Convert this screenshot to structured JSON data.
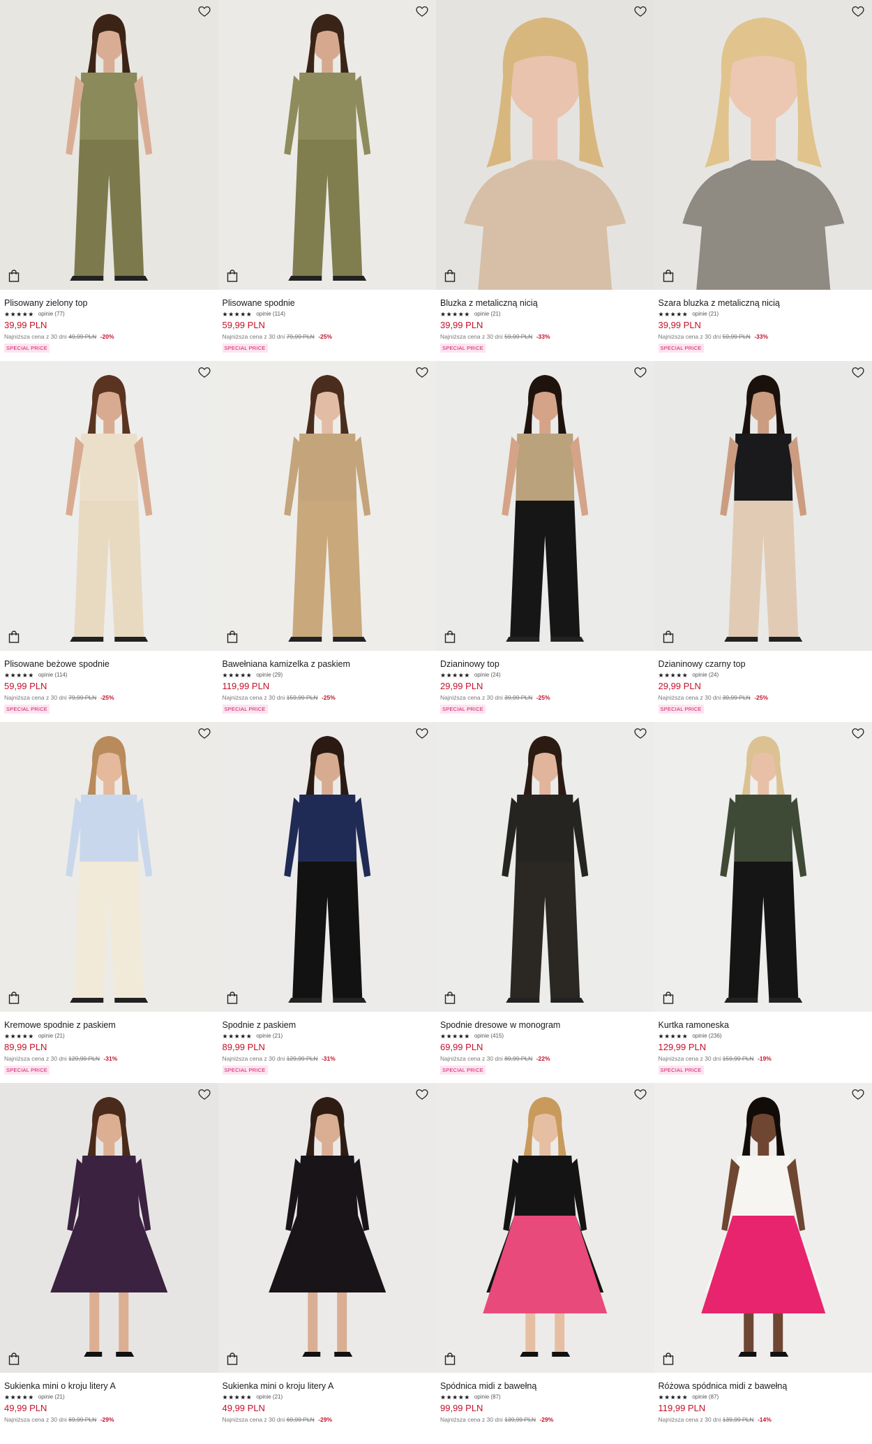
{
  "products": [
    {
      "name": "Plisowany zielony top",
      "stars": "★★★★★",
      "reviews": "opinie (77)",
      "price": "39,99 PLN",
      "lowest_label": "Najniższa cena z 30 dni",
      "old_price": "49,99 PLN",
      "discount": "-20%",
      "badge": "SPECIAL PRICE",
      "palette": {
        "bg": "#e8e6e1",
        "top": "#8a8a5a",
        "bottom": "#7c7a4c",
        "skin": "#d9ad94",
        "hair": "#3b2416"
      }
    },
    {
      "name": "Plisowane spodnie",
      "stars": "★★★★★",
      "reviews": "opinie (114)",
      "price": "59,99 PLN",
      "lowest_label": "Najniższa cena z 30 dni",
      "old_price": "79,99 PLN",
      "discount": "-25%",
      "badge": "SPECIAL PRICE",
      "palette": {
        "bg": "#ebeae6",
        "top": "#8e8b5c",
        "bottom": "#807d4f",
        "skin": "#d6a98f",
        "hair": "#3a2418"
      }
    },
    {
      "name": "Bluzka z metaliczną nicią",
      "stars": "★★★★★",
      "reviews": "opinie (21)",
      "price": "39,99 PLN",
      "lowest_label": "Najniższa cena z 30 dni",
      "old_price": "59,99 PLN",
      "discount": "-33%",
      "badge": "SPECIAL PRICE",
      "palette": {
        "bg": "#e4e3df",
        "top": "#d6bfa6",
        "bottom": "#d6bfa6",
        "skin": "#e9c3ad",
        "hair": "#d8b77e"
      }
    },
    {
      "name": "Szara bluzka z metaliczną nicią",
      "stars": "★★★★★",
      "reviews": "opinie (21)",
      "price": "39,99 PLN",
      "lowest_label": "Najniższa cena z 30 dni",
      "old_price": "59,99 PLN",
      "discount": "-33%",
      "badge": "SPECIAL PRICE",
      "palette": {
        "bg": "#e6e5e2",
        "top": "#8f8a82",
        "bottom": "#8f8a82",
        "skin": "#ecc8b3",
        "hair": "#e1c48d"
      }
    },
    {
      "name": "Plisowane beżowe spodnie",
      "stars": "★★★★★",
      "reviews": "opinie (114)",
      "price": "59,99 PLN",
      "lowest_label": "Najniższa cena z 30 dni",
      "old_price": "79,99 PLN",
      "discount": "-25%",
      "badge": "SPECIAL PRICE",
      "palette": {
        "bg": "#ededeb",
        "top": "#ecdfca",
        "bottom": "#e8d9c1",
        "skin": "#d8ab90",
        "hair": "#5a3421"
      }
    },
    {
      "name": "Bawełniana kamizelka z paskiem",
      "stars": "★★★★★",
      "reviews": "opinie (29)",
      "price": "119,99 PLN",
      "lowest_label": "Najniższa cena z 30 dni",
      "old_price": "159,99 PLN",
      "discount": "-25%",
      "badge": "SPECIAL PRICE",
      "palette": {
        "bg": "#eeedea",
        "top": "#c4a47a",
        "bottom": "#c9a87c",
        "skin": "#e2bca5",
        "hair": "#4a2d1d"
      }
    },
    {
      "name": "Dzianinowy top",
      "stars": "★★★★★",
      "reviews": "opinie (24)",
      "price": "29,99 PLN",
      "lowest_label": "Najniższa cena z 30 dni",
      "old_price": "39,99 PLN",
      "discount": "-25%",
      "badge": "SPECIAL PRICE",
      "palette": {
        "bg": "#ebebe9",
        "top": "#b9a27c",
        "bottom": "#161616",
        "skin": "#d4a388",
        "hair": "#1f130e"
      }
    },
    {
      "name": "Dzianinowy czarny top",
      "stars": "★★★★★",
      "reviews": "opinie (24)",
      "price": "29,99 PLN",
      "lowest_label": "Najniższa cena z 30 dni",
      "old_price": "39,99 PLN",
      "discount": "-25%",
      "badge": "SPECIAL PRICE",
      "palette": {
        "bg": "#e9e9e7",
        "top": "#1a1a1d",
        "bottom": "#e1cbb4",
        "skin": "#cc9c80",
        "hair": "#1a110c"
      }
    },
    {
      "name": "Kremowe spodnie z paskiem",
      "stars": "★★★★★",
      "reviews": "opinie (21)",
      "price": "89,99 PLN",
      "lowest_label": "Najniższa cena z 30 dni",
      "old_price": "129,99 PLN",
      "discount": "-31%",
      "badge": "SPECIAL PRICE",
      "palette": {
        "bg": "#ecebe8",
        "top": "#c9d7ec",
        "bottom": "#f1ead9",
        "skin": "#e4b99c",
        "hair": "#b98a5a"
      }
    },
    {
      "name": "Spodnie z paskiem",
      "stars": "★★★★★",
      "reviews": "opinie (21)",
      "price": "89,99 PLN",
      "lowest_label": "Najniższa cena z 30 dni",
      "old_price": "129,99 PLN",
      "discount": "-31%",
      "badge": "SPECIAL PRICE",
      "palette": {
        "bg": "#ecebea",
        "top": "#1f2a55",
        "bottom": "#121212",
        "skin": "#d7ab90",
        "hair": "#2a1a12"
      }
    },
    {
      "name": "Spodnie dresowe w monogram",
      "stars": "★★★★★",
      "reviews": "opinie (415)",
      "price": "69,99 PLN",
      "lowest_label": "Najniższa cena z 30 dni",
      "old_price": "89,99 PLN",
      "discount": "-22%",
      "badge": "SPECIAL PRICE",
      "palette": {
        "bg": "#ececea",
        "top": "#262421",
        "bottom": "#2b2823",
        "skin": "#e0b59b",
        "hair": "#2b1b12"
      }
    },
    {
      "name": "Kurtka ramoneska",
      "stars": "★★★★★",
      "reviews": "opinie (236)",
      "price": "129,99 PLN",
      "lowest_label": "Najniższa cena z 30 dni",
      "old_price": "159,99 PLN",
      "discount": "-19%",
      "badge": "SPECIAL PRICE",
      "palette": {
        "bg": "#eeeeec",
        "top": "#3f4a36",
        "bottom": "#151515",
        "skin": "#e8c0a7",
        "hair": "#dcc292"
      }
    },
    {
      "name": "Sukienka mini o kroju litery A",
      "stars": "★★★★★",
      "reviews": "opinie (21)",
      "price": "49,99 PLN",
      "lowest_label": "Najniższa cena z 30 dni",
      "old_price": "69,99 PLN",
      "discount": "-29%",
      "badge": "",
      "palette": {
        "bg": "#e6e5e3",
        "top": "#3a2240",
        "bottom": "#2a1a2e",
        "skin": "#dcae92",
        "hair": "#4a2a1a"
      }
    },
    {
      "name": "Sukienka mini o kroju litery A",
      "stars": "★★★★★",
      "reviews": "opinie (21)",
      "price": "49,99 PLN",
      "lowest_label": "Najniższa cena z 30 dni",
      "old_price": "69,99 PLN",
      "discount": "-29%",
      "badge": "",
      "palette": {
        "bg": "#ebeae8",
        "top": "#181418",
        "bottom": "#1a161a",
        "skin": "#d9ae93",
        "hair": "#2e1c13"
      }
    },
    {
      "name": "Spódnica midi z bawełną",
      "stars": "★★★★★",
      "reviews": "opinie (87)",
      "price": "99,99 PLN",
      "lowest_label": "Najniższa cena z 30 dni",
      "old_price": "139,99 PLN",
      "discount": "-29%",
      "badge": "",
      "palette": {
        "bg": "#ecebe9",
        "top": "#141414",
        "bottom": "#e84a7c",
        "skin": "#e6bfa3",
        "hair": "#c89a5c"
      }
    },
    {
      "name": "Różowa spódnica midi z bawełną",
      "stars": "★★★★★",
      "reviews": "opinie (87)",
      "price": "119,99 PLN",
      "lowest_label": "Najniższa cena z 30 dni",
      "old_price": "139,99 PLN",
      "discount": "-14%",
      "badge": "",
      "palette": {
        "bg": "#efeeec",
        "top": "#f7f5f2",
        "bottom": "#e8246e",
        "skin": "#6e4632",
        "hair": "#120c09"
      }
    }
  ]
}
